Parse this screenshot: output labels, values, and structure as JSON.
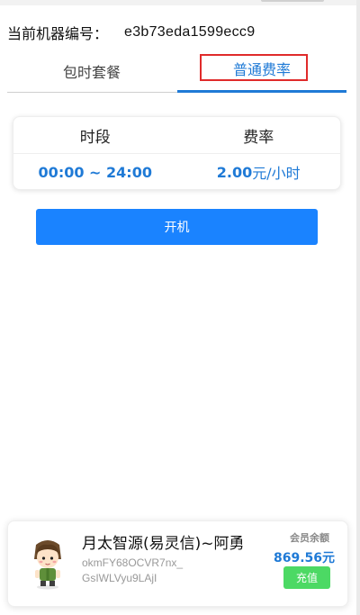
{
  "machine": {
    "label": "当前机器编号：",
    "id": "e3b73eda1599ecc9"
  },
  "tabs": [
    {
      "label": "包时套餐"
    },
    {
      "label": "普通费率"
    }
  ],
  "rate_table": {
    "headers": [
      "时段",
      "费率"
    ],
    "rows": [
      {
        "period": "00:00 ~ 24:00",
        "rate_value": "2.00",
        "rate_unit": "元/小时"
      }
    ]
  },
  "actions": {
    "start_label": "开机"
  },
  "user": {
    "name": "月太智源(易灵信)~阿勇",
    "id": "okmFY68OCVR7nx_GsIWLVyu9LAjI",
    "balance_label": "会员余额",
    "balance_value": "869.56元",
    "recharge_label": "充值"
  },
  "colors": {
    "accent": "#1f7ad6",
    "primary_button": "#1a83ff",
    "recharge_button": "#4cd964",
    "highlight_box": "#e02b2b"
  }
}
